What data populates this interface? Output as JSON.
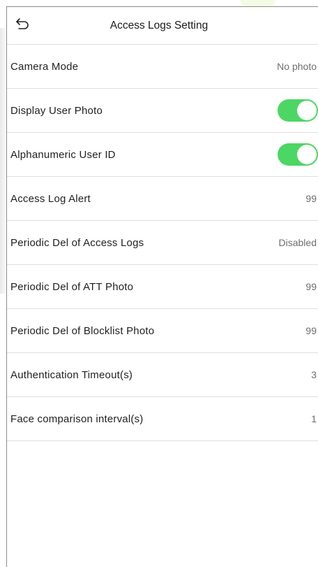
{
  "header": {
    "title": "Access Logs Setting",
    "back_icon": "back-arrow-icon"
  },
  "settings": [
    {
      "label": "Camera Mode",
      "type": "value",
      "value": "No photo"
    },
    {
      "label": "Display User Photo",
      "type": "toggle",
      "on": true
    },
    {
      "label": "Alphanumeric User ID",
      "type": "toggle",
      "on": true
    },
    {
      "label": "Access Log Alert",
      "type": "value",
      "value": "99"
    },
    {
      "label": "Periodic Del of Access Logs",
      "type": "value",
      "value": "Disabled"
    },
    {
      "label": "Periodic Del of ATT Photo",
      "type": "value",
      "value": "99"
    },
    {
      "label": "Periodic Del of Blocklist Photo",
      "type": "value",
      "value": "99"
    },
    {
      "label": "Authentication Timeout(s)",
      "type": "value",
      "value": "3"
    },
    {
      "label": "Face comparison interval(s)",
      "type": "value",
      "value": "1"
    }
  ],
  "colors": {
    "toggle_on": "#4cd664",
    "divider": "#dedede",
    "value_text": "#6e6e6e"
  }
}
